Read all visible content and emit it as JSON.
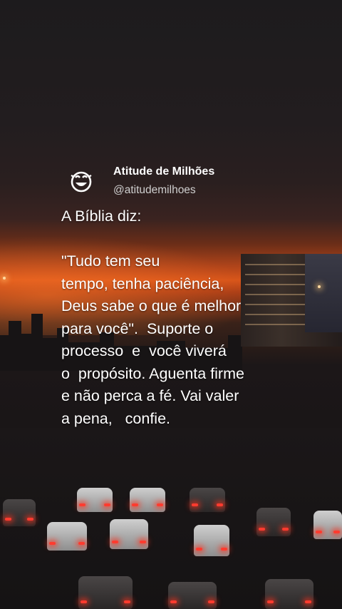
{
  "account": {
    "name": "Atitude de Milhões",
    "handle": "@atitudemilhoes",
    "avatar_icon": "smiley-logo-icon"
  },
  "post": {
    "intro": "A Bíblia diz:",
    "lines": [
      "\"Tudo tem seu",
      "tempo, tenha paciência,",
      "Deus sabe o que é melhor",
      "para você\".  Suporte o",
      "processo  e  você viverá",
      "o  propósito. Aguenta firme",
      "e não perca a fé. Vai valer",
      "a pena,   confie."
    ]
  },
  "colors": {
    "text": "#ffffff",
    "handle": "#cfcfcf",
    "sunset": "#d8551a",
    "sky": "#1d1b1d"
  }
}
